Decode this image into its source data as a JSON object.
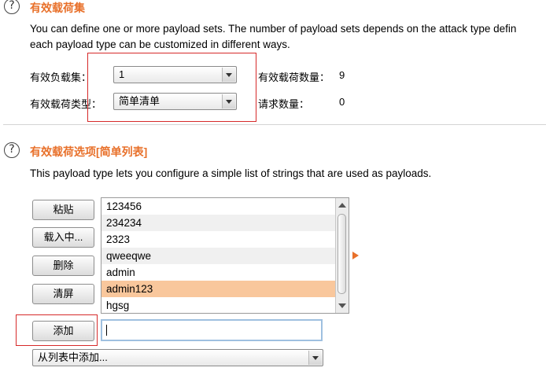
{
  "payload_sets": {
    "title": "有效载荷集",
    "description_line1": "You can define one or more payload sets. The number of payload sets depends on the attack type defin",
    "description_line2": "each payload type can be customized in different ways.",
    "set_label": "有效负载集：",
    "set_value": "1",
    "type_label": "有效载荷类型：",
    "type_value": "简单清单",
    "count_label": "有效载荷数量：",
    "count_value": "9",
    "request_label": "请求数量：",
    "request_value": "0"
  },
  "payload_options": {
    "title": "有效载荷选项[简单列表]",
    "description": "This payload type lets you configure a simple list of strings that are used as payloads.",
    "buttons": {
      "paste": "粘贴",
      "load": "载入中...",
      "remove": "删除",
      "clear": "清屏",
      "add": "添加"
    },
    "list_items": [
      "123456",
      "234234",
      "2323",
      "qweeqwe",
      "admin",
      "admin123",
      "hgsg"
    ],
    "selected_index": 5,
    "add_input_value": "",
    "add_from_list": "从列表中添加..."
  },
  "colors": {
    "accent": "#e8702a",
    "selection": "#f9c79c",
    "highlight_box": "#d62a2a"
  },
  "icons": {
    "help": "help-circle-icon",
    "dropdown": "chevron-down-icon",
    "side_arrow": "triangle-right-icon"
  },
  "help_glyph": "?"
}
